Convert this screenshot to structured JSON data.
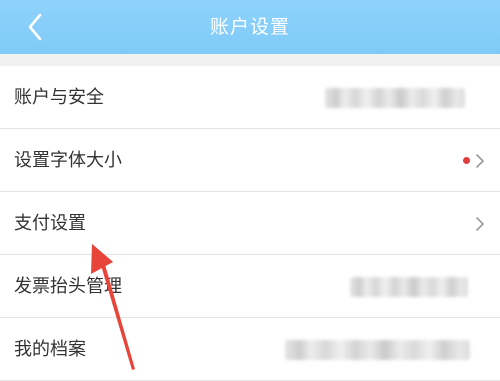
{
  "header": {
    "title": "账户设置",
    "background": "#86cff9"
  },
  "settings": {
    "items": [
      {
        "label": "账户与安全",
        "has_blurred_value": true,
        "has_dot": false,
        "has_chevron": false
      },
      {
        "label": "设置字体大小",
        "has_blurred_value": false,
        "has_dot": true,
        "has_chevron": true
      },
      {
        "label": "支付设置",
        "has_blurred_value": false,
        "has_dot": false,
        "has_chevron": true
      },
      {
        "label": "发票抬头管理",
        "has_blurred_value": true,
        "has_dot": false,
        "has_chevron": false
      },
      {
        "label": "我的档案",
        "has_blurred_value": true,
        "has_dot": false,
        "has_chevron": false
      }
    ]
  },
  "colors": {
    "dot": "#e23b3b",
    "annotation_arrow": "#e8453a",
    "text": "#333333"
  },
  "annotation": {
    "type": "arrow",
    "points_to": "支付设置"
  }
}
